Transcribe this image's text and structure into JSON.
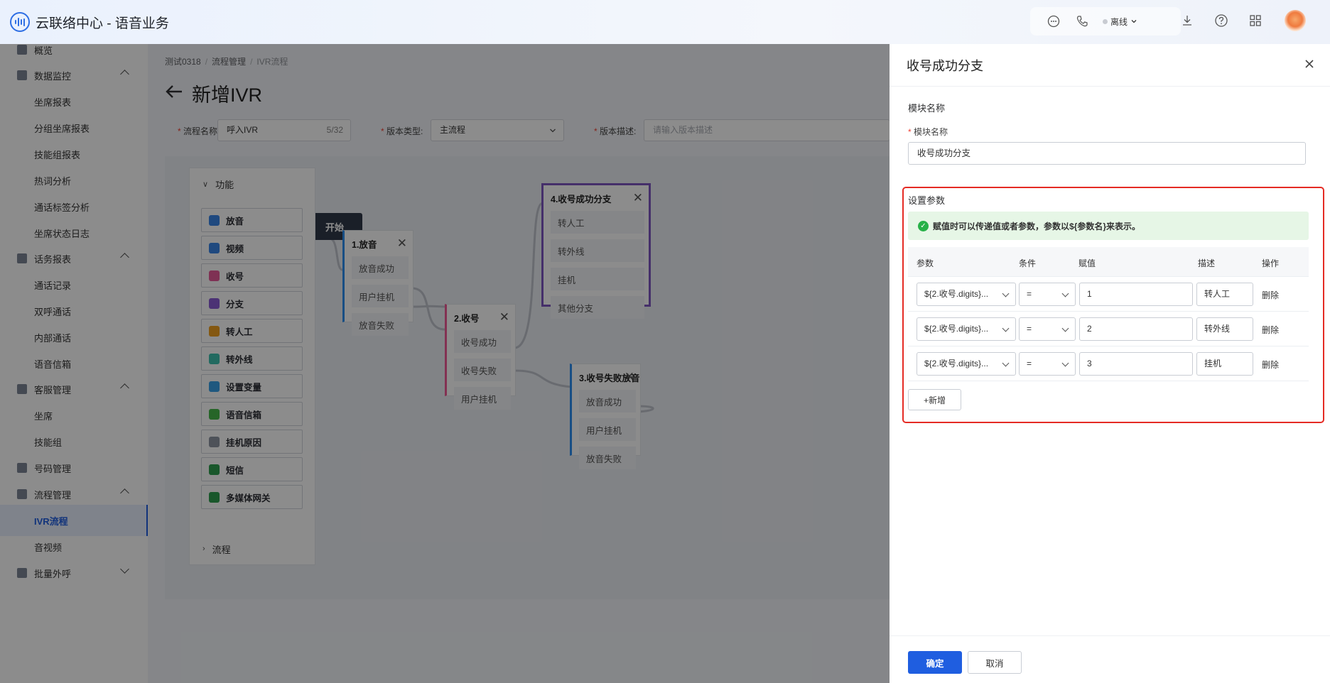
{
  "app": {
    "title": "云联络中心 - 语音业务"
  },
  "topbar": {
    "status_label": "离线"
  },
  "sidebar": {
    "items": [
      {
        "label": "概览",
        "type": "group",
        "icon": "overview-icon"
      },
      {
        "label": "数据监控",
        "type": "group",
        "icon": "monitor-icon",
        "expanded": true
      },
      {
        "label": "坐席报表",
        "type": "sub"
      },
      {
        "label": "分组坐席报表",
        "type": "sub"
      },
      {
        "label": "技能组报表",
        "type": "sub"
      },
      {
        "label": "热词分析",
        "type": "sub"
      },
      {
        "label": "通话标签分析",
        "type": "sub"
      },
      {
        "label": "坐席状态日志",
        "type": "sub"
      },
      {
        "label": "话务报表",
        "type": "group",
        "icon": "report-icon",
        "expanded": true
      },
      {
        "label": "通话记录",
        "type": "sub"
      },
      {
        "label": "双呼通话",
        "type": "sub"
      },
      {
        "label": "内部通话",
        "type": "sub"
      },
      {
        "label": "语音信箱",
        "type": "sub"
      },
      {
        "label": "客服管理",
        "type": "group",
        "icon": "headset-icon",
        "expanded": true
      },
      {
        "label": "坐席",
        "type": "sub"
      },
      {
        "label": "技能组",
        "type": "sub"
      },
      {
        "label": "号码管理",
        "type": "group",
        "icon": "phone-icon"
      },
      {
        "label": "流程管理",
        "type": "group",
        "icon": "flow-icon",
        "expanded": true
      },
      {
        "label": "IVR流程",
        "type": "sub",
        "active": true
      },
      {
        "label": "音视频",
        "type": "sub"
      },
      {
        "label": "批量外呼",
        "type": "group",
        "icon": "outbound-icon",
        "expanded": false
      }
    ]
  },
  "breadcrumb": [
    "测试0318",
    "流程管理",
    "IVR流程"
  ],
  "page": {
    "title": "新增IVR"
  },
  "form": {
    "flow_name_label": "流程名称:",
    "flow_name_value": "呼入IVR",
    "flow_name_count": "5/32",
    "version_type_label": "版本类型:",
    "version_type_value": "主流程",
    "version_desc_label": "版本描述:",
    "version_desc_placeholder": "请输入版本描述"
  },
  "palette": {
    "section_function": "功能",
    "section_flow": "流程",
    "items": [
      {
        "label": "放音",
        "color": "#3a86e8"
      },
      {
        "label": "视频",
        "color": "#3a86e8"
      },
      {
        "label": "收号",
        "color": "#e85a9a"
      },
      {
        "label": "分支",
        "color": "#8a5cd6"
      },
      {
        "label": "转人工",
        "color": "#f0a020"
      },
      {
        "label": "转外线",
        "color": "#3ec1b0"
      },
      {
        "label": "设置变量",
        "color": "#3aa0e8"
      },
      {
        "label": "语音信箱",
        "color": "#46b84a"
      },
      {
        "label": "挂机原因",
        "color": "#8f96a3"
      },
      {
        "label": "短信",
        "color": "#2e9e4f"
      },
      {
        "label": "多媒体网关",
        "color": "#2e9e4f"
      }
    ]
  },
  "canvas": {
    "start_label": "开始",
    "nodes": [
      {
        "title": "1.放音",
        "branches": [
          "放音成功",
          "用户挂机",
          "放音失败"
        ]
      },
      {
        "title": "2.收号",
        "branches": [
          "收号成功",
          "收号失败",
          "用户挂机"
        ]
      },
      {
        "title": "3.收号失败放音",
        "branches": [
          "放音成功",
          "用户挂机",
          "放音失败"
        ]
      },
      {
        "title": "4.收号成功分支",
        "branches": [
          "转人工",
          "转外线",
          "挂机",
          "其他分支"
        ]
      }
    ]
  },
  "drawer": {
    "title": "收号成功分支",
    "module_section": "模块名称",
    "module_name_label": "模块名称",
    "module_name_value": "收号成功分支",
    "params_section": "设置参数",
    "tip": "赋值时可以传递值或者参数，参数以${参数名}来表示。",
    "columns": [
      "参数",
      "条件",
      "赋值",
      "描述",
      "操作"
    ],
    "rows": [
      {
        "param": "${2.收号.digits}...",
        "cond": "=",
        "value": "1",
        "desc": "转人工",
        "action": "删除"
      },
      {
        "param": "${2.收号.digits}...",
        "cond": "=",
        "value": "2",
        "desc": "转外线",
        "action": "删除"
      },
      {
        "param": "${2.收号.digits}...",
        "cond": "=",
        "value": "3",
        "desc": "挂机",
        "action": "删除"
      }
    ],
    "add_label": "+新增",
    "confirm_label": "确定",
    "cancel_label": "取消"
  }
}
